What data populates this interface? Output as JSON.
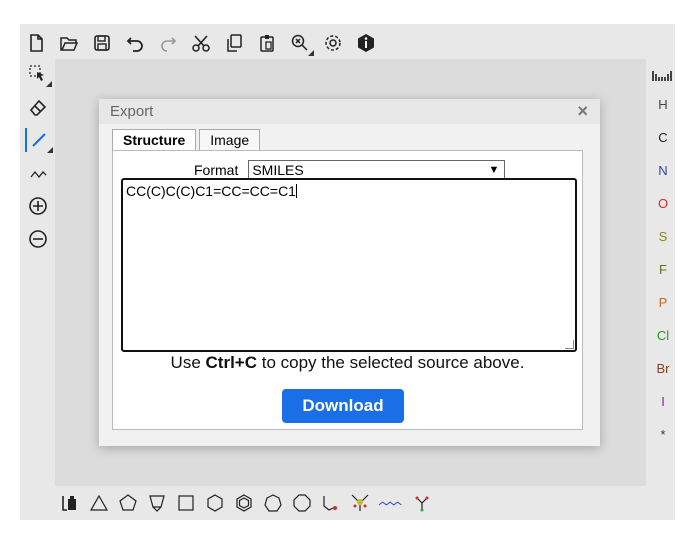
{
  "toolbar_top": {
    "icons": [
      "new-file-icon",
      "open-folder-icon",
      "save-icon",
      "undo-icon",
      "redo-icon",
      "cut-icon",
      "copy-icon",
      "paste-icon",
      "zoom-icon",
      "settings-icon",
      "info-icon"
    ]
  },
  "toolbar_left": {
    "icons": [
      "select-icon",
      "eraser-icon",
      "bond-icon",
      "chain-icon",
      "charge-plus-icon",
      "charge-minus-icon"
    ]
  },
  "atoms": {
    "items": [
      "H",
      "C",
      "N",
      "O",
      "S",
      "F",
      "P",
      "Cl",
      "Br",
      "I",
      "*"
    ],
    "colors": [
      "#444444",
      "#222222",
      "#2e46b8",
      "#d12d2d",
      "#8a8a1e",
      "#6f6f1a",
      "#c76a1e",
      "#1f9b1f",
      "#8b3d1e",
      "#7a2f8c",
      "#333333"
    ]
  },
  "dialog": {
    "title": "Export",
    "close": "×",
    "tabs": [
      "Structure",
      "Image"
    ],
    "format_label": "Format",
    "format_value": "SMILES",
    "text_value": "CC(C)C(C)C1=CC=CC=C1",
    "hint_pre": "Use ",
    "hint_bold": "Ctrl+C",
    "hint_post": " to copy the selected source above.",
    "download_label": "Download"
  },
  "accent_color": "#1a6fe6"
}
